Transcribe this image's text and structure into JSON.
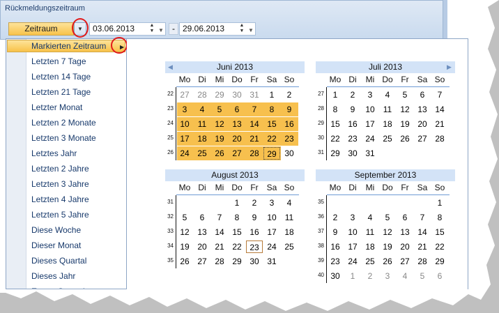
{
  "panel": {
    "title": "Rückmeldungszeitraum"
  },
  "toolbar": {
    "range_button_label": "Zeitraum",
    "from_date": "03.06.2013",
    "to_date": "29.06.2013",
    "separator": "-"
  },
  "menu": {
    "highlighted": "Markierten Zeitraum",
    "items": [
      "Letzten 7 Tage",
      "Letzten 14 Tage",
      "Letzten 21 Tage",
      "Letzter Monat",
      "Letzten 2 Monate",
      "Letzten 3 Monate",
      "Letztes Jahr",
      "Letzten 2 Jahre",
      "Letzten 3 Jahre",
      "Letzten 4 Jahre",
      "Letzten 5 Jahre",
      "Diese Woche",
      "Dieser Monat",
      "Dieses Quartal",
      "Dieses Jahr",
      "Erstes Quartal"
    ]
  },
  "weekday_labels": [
    "Mo",
    "Di",
    "Mi",
    "Do",
    "Fr",
    "Sa",
    "So"
  ],
  "calendars": [
    {
      "title": "Juni 2013",
      "weeks": [
        {
          "wk": "22",
          "days": [
            "27",
            "28",
            "29",
            "30",
            "31",
            "1",
            "2"
          ],
          "other": [
            1,
            1,
            1,
            1,
            1,
            0,
            0
          ]
        },
        {
          "wk": "23",
          "days": [
            "3",
            "4",
            "5",
            "6",
            "7",
            "8",
            "9"
          ],
          "other": [
            0,
            0,
            0,
            0,
            0,
            0,
            0
          ]
        },
        {
          "wk": "24",
          "days": [
            "10",
            "11",
            "12",
            "13",
            "14",
            "15",
            "16"
          ],
          "other": [
            0,
            0,
            0,
            0,
            0,
            0,
            0
          ]
        },
        {
          "wk": "25",
          "days": [
            "17",
            "18",
            "19",
            "20",
            "21",
            "22",
            "23"
          ],
          "other": [
            0,
            0,
            0,
            0,
            0,
            0,
            0
          ]
        },
        {
          "wk": "26",
          "days": [
            "24",
            "25",
            "26",
            "27",
            "28",
            "29",
            "30"
          ],
          "other": [
            0,
            0,
            0,
            0,
            0,
            0,
            0
          ]
        }
      ],
      "selected_from": "3",
      "selected_to": "29",
      "focus_day": "29"
    },
    {
      "title": "Juli 2013",
      "weeks": [
        {
          "wk": "27",
          "days": [
            "1",
            "2",
            "3",
            "4",
            "5",
            "6",
            "7"
          ],
          "other": [
            0,
            0,
            0,
            0,
            0,
            0,
            0
          ]
        },
        {
          "wk": "28",
          "days": [
            "8",
            "9",
            "10",
            "11",
            "12",
            "13",
            "14"
          ],
          "other": [
            0,
            0,
            0,
            0,
            0,
            0,
            0
          ]
        },
        {
          "wk": "29",
          "days": [
            "15",
            "16",
            "17",
            "18",
            "19",
            "20",
            "21"
          ],
          "other": [
            0,
            0,
            0,
            0,
            0,
            0,
            0
          ]
        },
        {
          "wk": "30",
          "days": [
            "22",
            "23",
            "24",
            "25",
            "26",
            "27",
            "28"
          ],
          "other": [
            0,
            0,
            0,
            0,
            0,
            0,
            0
          ]
        },
        {
          "wk": "31",
          "days": [
            "29",
            "30",
            "31",
            "",
            "",
            "",
            ""
          ],
          "other": [
            0,
            0,
            0,
            0,
            0,
            0,
            0
          ]
        }
      ]
    },
    {
      "title": "August 2013",
      "weeks": [
        {
          "wk": "31",
          "days": [
            "",
            "",
            "",
            "1",
            "2",
            "3",
            "4"
          ],
          "other": [
            0,
            0,
            0,
            0,
            0,
            0,
            0
          ]
        },
        {
          "wk": "32",
          "days": [
            "5",
            "6",
            "7",
            "8",
            "9",
            "10",
            "11"
          ],
          "other": [
            0,
            0,
            0,
            0,
            0,
            0,
            0
          ]
        },
        {
          "wk": "33",
          "days": [
            "12",
            "13",
            "14",
            "15",
            "16",
            "17",
            "18"
          ],
          "other": [
            0,
            0,
            0,
            0,
            0,
            0,
            0
          ]
        },
        {
          "wk": "34",
          "days": [
            "19",
            "20",
            "21",
            "22",
            "23",
            "24",
            "25"
          ],
          "other": [
            0,
            0,
            0,
            0,
            0,
            0,
            0
          ]
        },
        {
          "wk": "35",
          "days": [
            "26",
            "27",
            "28",
            "29",
            "30",
            "31",
            ""
          ],
          "other": [
            0,
            0,
            0,
            0,
            0,
            0,
            0
          ]
        }
      ],
      "today_day": "23"
    },
    {
      "title": "September 2013",
      "weeks": [
        {
          "wk": "35",
          "days": [
            "",
            "",
            "",
            "",
            "",
            "",
            "1"
          ],
          "other": [
            0,
            0,
            0,
            0,
            0,
            0,
            0
          ]
        },
        {
          "wk": "36",
          "days": [
            "2",
            "3",
            "4",
            "5",
            "6",
            "7",
            "8"
          ],
          "other": [
            0,
            0,
            0,
            0,
            0,
            0,
            0
          ]
        },
        {
          "wk": "37",
          "days": [
            "9",
            "10",
            "11",
            "12",
            "13",
            "14",
            "15"
          ],
          "other": [
            0,
            0,
            0,
            0,
            0,
            0,
            0
          ]
        },
        {
          "wk": "38",
          "days": [
            "16",
            "17",
            "18",
            "19",
            "20",
            "21",
            "22"
          ],
          "other": [
            0,
            0,
            0,
            0,
            0,
            0,
            0
          ]
        },
        {
          "wk": "39",
          "days": [
            "23",
            "24",
            "25",
            "26",
            "27",
            "28",
            "29"
          ],
          "other": [
            0,
            0,
            0,
            0,
            0,
            0,
            0
          ]
        },
        {
          "wk": "40",
          "days": [
            "30",
            "1",
            "2",
            "3",
            "4",
            "5",
            "6"
          ],
          "other": [
            0,
            1,
            1,
            1,
            1,
            1,
            1
          ]
        }
      ]
    }
  ],
  "colors": {
    "selection": "#f7c04e",
    "accent": "#e21a1a"
  }
}
